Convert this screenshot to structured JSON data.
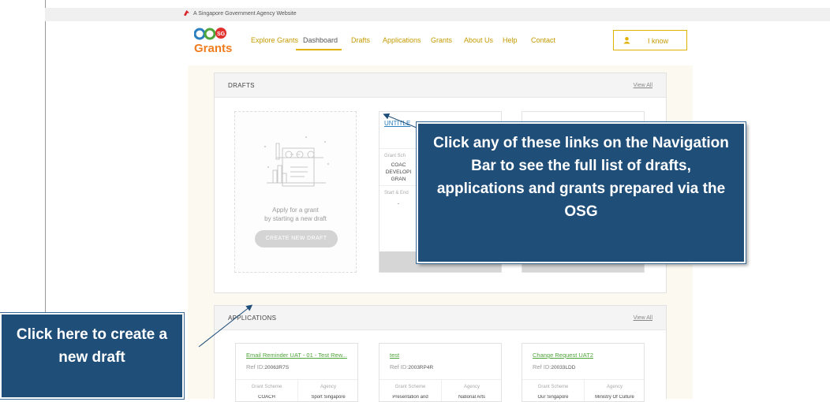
{
  "gov_banner": {
    "text": "A Singapore Government Agency Website"
  },
  "logo": {
    "text": "OurSG Grants"
  },
  "nav": {
    "items": [
      {
        "label": "Explore Grants"
      },
      {
        "label": "Dashboard"
      },
      {
        "label": "Drafts"
      },
      {
        "label": "Applications"
      },
      {
        "label": "Grants"
      },
      {
        "label": "About Us"
      },
      {
        "label": "Help"
      },
      {
        "label": "Contact"
      }
    ],
    "user_label": "I know"
  },
  "drafts_panel": {
    "title": "DRAFTS",
    "view_all": "View All",
    "new_card": {
      "line1": "Apply for a grant",
      "line2": "by starting a new draft",
      "button": "CREATE NEW DRAFT"
    },
    "draft_card": {
      "title": "UNTITLE",
      "scheme_label": "Grant Sch",
      "scheme_value_1": "COAC",
      "scheme_value_2": "DEVELOPI",
      "scheme_value_3": "GRAN",
      "dates_label": "Start & End",
      "dates_value": "-"
    }
  },
  "applications_panel": {
    "title": "APPLICATIONS",
    "view_all": "View All",
    "cards": [
      {
        "title": "Email Reminder UAT - 01 - Test Rew...",
        "ref_label": "Ref ID:",
        "ref": "20063R7S",
        "col1_label": "Grant Scheme",
        "col2_label": "Agency",
        "col1_value": "COACH",
        "col2_value": "Sport Singapore"
      },
      {
        "title": "test",
        "ref_label": "Ref ID:",
        "ref": "2003RP4R",
        "col1_label": "Grant Scheme",
        "col2_label": "Agency",
        "col1_value": "Presentation and",
        "col2_value": "National Arts"
      },
      {
        "title": "Change Request UAT2",
        "ref_label": "Ref ID:",
        "ref": "20033LDD",
        "col1_label": "Grant Scheme",
        "col2_label": "Agency",
        "col1_value": "Our Singapore",
        "col2_value": "Ministry Of Culture"
      }
    ]
  },
  "callouts": {
    "main": "Click any of these links on the Navigation Bar to see the full list of drafts, applications and grants prepared via the OSG",
    "left": "Click here to create a new draft"
  },
  "colors": {
    "accent": "#c49a00",
    "callout": "#1f4e79",
    "link_green": "#4fa63a",
    "link_blue": "#2a7fc0"
  }
}
